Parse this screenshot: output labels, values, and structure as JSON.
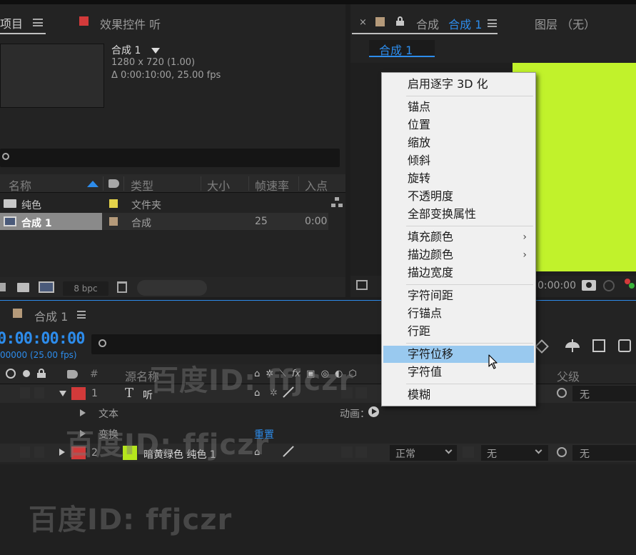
{
  "project_panel": {
    "tab_label": "项目",
    "tab_menu_icon": "hamburger-icon",
    "effects_tab_label": "效果控件 听",
    "comp_name": "合成 1",
    "comp_resolution": "1280 x 720 (1.00)",
    "comp_duration": "Δ 0:00:10:00, 25.00 fps",
    "columns": {
      "name": "名称",
      "type": "类型",
      "size": "大小",
      "fps": "帧速率",
      "in": "入点"
    },
    "rows": [
      {
        "name": "纯色",
        "color": "#e5d34a",
        "type": "文件夹",
        "fps": "",
        "in": ""
      },
      {
        "name": "合成 1",
        "color": "#b59a7a",
        "type": "合成",
        "fps": "25",
        "in": "0:00"
      }
    ],
    "bpc": "8 bpc"
  },
  "composition_viewer": {
    "tab_label": "合成",
    "tab_active": "合成 1",
    "layer_tab": "图层 （无）",
    "breadcrumb": "合成 1",
    "timecode": "0:00:00",
    "canvas_color": "#c1f22b"
  },
  "timeline": {
    "tab_label": "合成 1",
    "timecode": "0:00:00:00",
    "frame_info": "00000 (25.00 fps)",
    "columns": {
      "source_name": "源名称",
      "parent": "父级"
    },
    "layers": [
      {
        "index": "1",
        "color": "#d23a3a",
        "type_glyph": "T",
        "name": "听",
        "parent": "无"
      },
      {
        "index": "2",
        "color": "#d23a3a",
        "solid_color": "#b5e61d",
        "name": "暗黄绿色 纯色 1",
        "mode": "正常",
        "trkmat": "无",
        "parent": "无"
      }
    ],
    "sub_text": "文本",
    "sub_transform": "变换",
    "animate_label": "动画：",
    "reset_label": "重置"
  },
  "context_menu": {
    "items": [
      {
        "label": "启用逐字 3D 化",
        "submenu": false
      },
      {
        "label": "锚点",
        "submenu": false
      },
      {
        "label": "位置",
        "submenu": false
      },
      {
        "label": "缩放",
        "submenu": false
      },
      {
        "label": "倾斜",
        "submenu": false
      },
      {
        "label": "旋转",
        "submenu": false
      },
      {
        "label": "不透明度",
        "submenu": false
      },
      {
        "label": "全部变换属性",
        "submenu": false
      },
      {
        "label": "填充颜色",
        "submenu": true
      },
      {
        "label": "描边颜色",
        "submenu": true
      },
      {
        "label": "描边宽度",
        "submenu": false
      },
      {
        "label": "字符间距",
        "submenu": false
      },
      {
        "label": "行锚点",
        "submenu": false
      },
      {
        "label": "行距",
        "submenu": false
      },
      {
        "label": "字符位移",
        "submenu": false,
        "highlighted": true
      },
      {
        "label": "字符值",
        "submenu": false
      },
      {
        "label": "模糊",
        "submenu": false
      }
    ],
    "submenu_arrow": "›"
  },
  "watermarks": [
    "百度ID: ffjczr",
    "百度ID: ffjczr",
    "百度ID: ffjczr"
  ]
}
